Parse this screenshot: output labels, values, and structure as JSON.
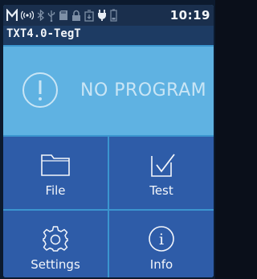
{
  "status_bar": {
    "time": "10:19",
    "icons": [
      "m-icon",
      "wireless-broadcast-icon",
      "bluetooth-icon",
      "usb-icon",
      "memory-card-icon",
      "lock-icon",
      "update-icon",
      "power-plug-icon",
      "battery-icon"
    ]
  },
  "header": {
    "device_name": "TXT4.0-TegT"
  },
  "banner": {
    "icon": "exclamation-circle-icon",
    "message": "NO PROGRAM"
  },
  "tiles": [
    {
      "label": "File",
      "icon": "folder-icon"
    },
    {
      "label": "Test",
      "icon": "checkbox-icon"
    },
    {
      "label": "Settings",
      "icon": "gear-icon"
    },
    {
      "label": "Info",
      "icon": "info-icon"
    }
  ],
  "colors": {
    "status_bar": "#1a2f4d",
    "title_bar": "#1d3b63",
    "banner": "#5fb2e2",
    "tile": "#2e5ca8",
    "screen_bg": "#3b95cf"
  }
}
